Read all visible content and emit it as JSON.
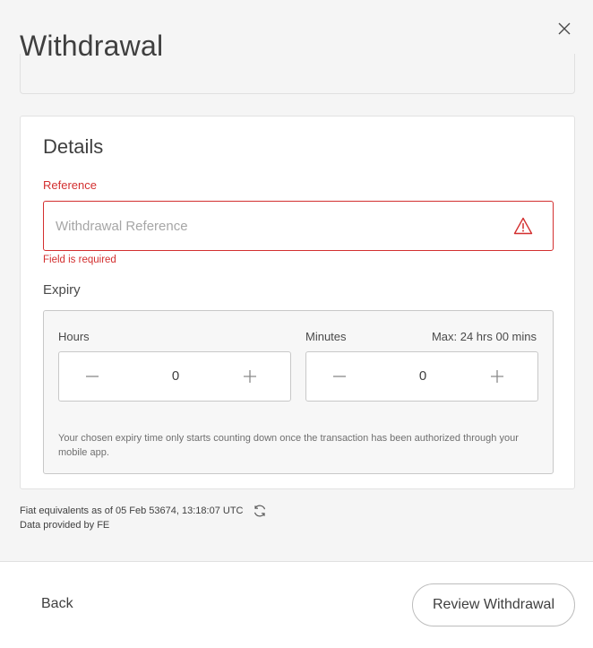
{
  "header": {
    "title": "Withdrawal",
    "close_icon": "close-icon"
  },
  "details": {
    "title": "Details",
    "reference": {
      "label": "Reference",
      "placeholder": "Withdrawal Reference",
      "value": "",
      "error": "Field is required",
      "status_icon": "warning-triangle-icon"
    },
    "expiry": {
      "label": "Expiry",
      "hours": {
        "label": "Hours",
        "value": "0"
      },
      "minutes": {
        "label": "Minutes",
        "value": "0"
      },
      "max_label": "Max: 24 hrs 00 mins",
      "note": "Your chosen expiry time only starts counting down once the transaction has been authorized through your mobile app."
    }
  },
  "fiat": {
    "line": "Fiat equivalents as of 05 Feb 53674, 13:18:07  UTC",
    "provider": "Data provided by FE",
    "refresh_icon": "refresh-icon"
  },
  "footer": {
    "back_label": "Back",
    "review_label": "Review Withdrawal"
  },
  "colors": {
    "error": "#d32f2f",
    "background": "#f5f5f5",
    "card": "#ffffff"
  }
}
